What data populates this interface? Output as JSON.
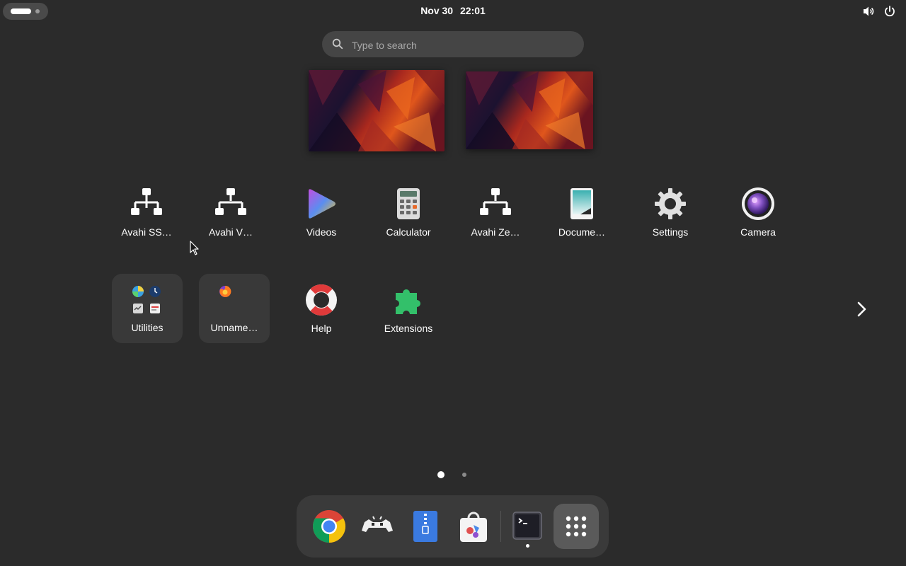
{
  "topbar": {
    "date": "Nov 30",
    "time": "22:01",
    "icons": [
      "volume-icon",
      "power-icon"
    ]
  },
  "search": {
    "placeholder": "Type to search"
  },
  "workspaces": [
    "workspace-1",
    "workspace-2"
  ],
  "apps_row1": [
    {
      "label": "Avahi SS…",
      "icon": "network-icon"
    },
    {
      "label": "Avahi V…",
      "icon": "network-icon"
    },
    {
      "label": "Videos",
      "icon": "videos-icon"
    },
    {
      "label": "Calculator",
      "icon": "calculator-icon"
    },
    {
      "label": "Avahi Ze…",
      "icon": "network-icon"
    },
    {
      "label": "Docume…",
      "icon": "document-viewer-icon"
    },
    {
      "label": "Settings",
      "icon": "gear-icon"
    },
    {
      "label": "Camera",
      "icon": "camera-icon"
    }
  ],
  "apps_row2": [
    {
      "label": "Utilities",
      "icon": "folder-icon"
    },
    {
      "label": "Unname…",
      "icon": "folder-icon"
    },
    {
      "label": "Help",
      "icon": "lifebuoy-icon"
    },
    {
      "label": "Extensions",
      "icon": "puzzle-icon"
    }
  ],
  "pagination": {
    "pages": 2,
    "current": 1
  },
  "dock": [
    {
      "name": "chrome",
      "icon": "chrome-icon"
    },
    {
      "name": "retroarch",
      "icon": "gamepad-icon"
    },
    {
      "name": "archive-manager",
      "icon": "archive-icon"
    },
    {
      "name": "software",
      "icon": "software-store-icon"
    },
    {
      "name": "terminal",
      "icon": "terminal-icon",
      "running": true
    },
    {
      "name": "show-apps",
      "icon": "app-grid-icon"
    }
  ],
  "colors": {
    "background": "#2b2b2b",
    "dock": "#3a3a3a",
    "search": "#454545",
    "folder": "#393939",
    "extensions_green": "#33c06a"
  }
}
